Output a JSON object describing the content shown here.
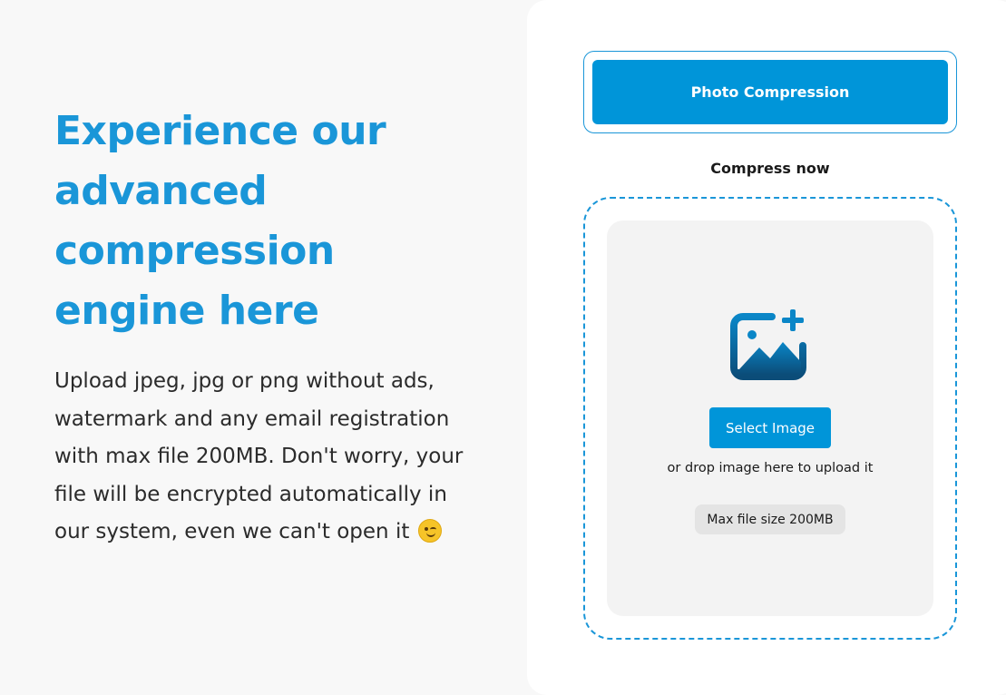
{
  "hero": {
    "title": "Experience our\nadvanced\ncompression\nengine here",
    "description": "Upload jpeg, jpg or png without ads, watermark and any email registration with max file 200MB. Don't worry, your file will be encrypted automatically in our system, even we can't open it",
    "emoji_icon": "winking-face-icon"
  },
  "panel": {
    "tab_label": "Photo Compression",
    "heading": "Compress now",
    "dropzone": {
      "icon": "image-add-icon",
      "select_button": "Select Image",
      "hint": "or drop image here to upload it",
      "max_size_badge": "Max file size 200MB"
    }
  },
  "colors": {
    "accent": "#0095d9",
    "title": "#1a96d8",
    "background": "#f8f8f8",
    "card": "#ffffff",
    "dropzone_fill": "#f3f3f3"
  }
}
